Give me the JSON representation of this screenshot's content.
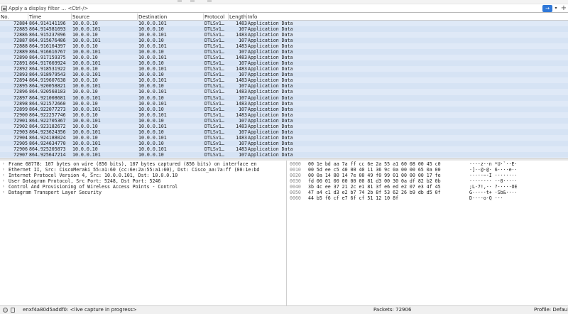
{
  "filter": {
    "placeholder": "Apply a display filter … <Ctrl-/>",
    "apply_glyph": "→",
    "dropdown_glyph": "▾",
    "add_glyph": "+"
  },
  "columns": [
    "No.",
    "Time",
    "Source",
    "Destination",
    "Protocol",
    "Length",
    "Info"
  ],
  "packets": [
    {
      "no": "72884",
      "time": "864.914141196",
      "src": "10.0.0.10",
      "dst": "10.0.0.101",
      "proto": "DTLSv1…",
      "len": "1483",
      "info": "Application Data"
    },
    {
      "no": "72885",
      "time": "864.914581693",
      "src": "10.0.0.101",
      "dst": "10.0.0.10",
      "proto": "DTLSv1…",
      "len": "107",
      "info": "Application Data"
    },
    {
      "no": "72886",
      "time": "864.915237096",
      "src": "10.0.0.10",
      "dst": "10.0.0.101",
      "proto": "DTLSv1…",
      "len": "1483",
      "info": "Application Data"
    },
    {
      "no": "72887",
      "time": "864.915676486",
      "src": "10.0.0.101",
      "dst": "10.0.0.10",
      "proto": "DTLSv1…",
      "len": "107",
      "info": "Application Data"
    },
    {
      "no": "72888",
      "time": "864.916164397",
      "src": "10.0.0.10",
      "dst": "10.0.0.101",
      "proto": "DTLSv1…",
      "len": "1483",
      "info": "Application Data"
    },
    {
      "no": "72889",
      "time": "864.916616767",
      "src": "10.0.0.101",
      "dst": "10.0.0.10",
      "proto": "DTLSv1…",
      "len": "107",
      "info": "Application Data"
    },
    {
      "no": "72890",
      "time": "864.917159375",
      "src": "10.0.0.10",
      "dst": "10.0.0.101",
      "proto": "DTLSv1…",
      "len": "1483",
      "info": "Application Data"
    },
    {
      "no": "72891",
      "time": "864.917669924",
      "src": "10.0.0.101",
      "dst": "10.0.0.10",
      "proto": "DTLSv1…",
      "len": "107",
      "info": "Application Data"
    },
    {
      "no": "72892",
      "time": "864.918531922",
      "src": "10.0.0.10",
      "dst": "10.0.0.101",
      "proto": "DTLSv1…",
      "len": "1483",
      "info": "Application Data"
    },
    {
      "no": "72893",
      "time": "864.918979543",
      "src": "10.0.0.101",
      "dst": "10.0.0.10",
      "proto": "DTLSv1…",
      "len": "107",
      "info": "Application Data"
    },
    {
      "no": "72894",
      "time": "864.919607638",
      "src": "10.0.0.10",
      "dst": "10.0.0.101",
      "proto": "DTLSv1…",
      "len": "1483",
      "info": "Application Data"
    },
    {
      "no": "72895",
      "time": "864.920058821",
      "src": "10.0.0.101",
      "dst": "10.0.0.10",
      "proto": "DTLSv1…",
      "len": "107",
      "info": "Application Data"
    },
    {
      "no": "72896",
      "time": "864.920568183",
      "src": "10.0.0.10",
      "dst": "10.0.0.101",
      "proto": "DTLSv1…",
      "len": "1483",
      "info": "Application Data"
    },
    {
      "no": "72897",
      "time": "864.921008681",
      "src": "10.0.0.101",
      "dst": "10.0.0.10",
      "proto": "DTLSv1…",
      "len": "107",
      "info": "Application Data"
    },
    {
      "no": "72898",
      "time": "864.921572660",
      "src": "10.0.0.10",
      "dst": "10.0.0.101",
      "proto": "DTLSv1…",
      "len": "1483",
      "info": "Application Data"
    },
    {
      "no": "72899",
      "time": "864.922077273",
      "src": "10.0.0.101",
      "dst": "10.0.0.10",
      "proto": "DTLSv1…",
      "len": "107",
      "info": "Application Data"
    },
    {
      "no": "72900",
      "time": "864.922257746",
      "src": "10.0.0.10",
      "dst": "10.0.0.101",
      "proto": "DTLSv1…",
      "len": "1483",
      "info": "Application Data"
    },
    {
      "no": "72901",
      "time": "864.922705367",
      "src": "10.0.0.101",
      "dst": "10.0.0.10",
      "proto": "DTLSv1…",
      "len": "107",
      "info": "Application Data"
    },
    {
      "no": "72902",
      "time": "864.923182672",
      "src": "10.0.0.10",
      "dst": "10.0.0.101",
      "proto": "DTLSv1…",
      "len": "1483",
      "info": "Application Data"
    },
    {
      "no": "72903",
      "time": "864.923624356",
      "src": "10.0.0.101",
      "dst": "10.0.0.10",
      "proto": "DTLSv1…",
      "len": "107",
      "info": "Application Data"
    },
    {
      "no": "72904",
      "time": "864.924188024",
      "src": "10.0.0.10",
      "dst": "10.0.0.101",
      "proto": "DTLSv1…",
      "len": "1483",
      "info": "Application Data"
    },
    {
      "no": "72905",
      "time": "864.924634770",
      "src": "10.0.0.101",
      "dst": "10.0.0.10",
      "proto": "DTLSv1…",
      "len": "107",
      "info": "Application Data"
    },
    {
      "no": "72906",
      "time": "864.925205873",
      "src": "10.0.0.10",
      "dst": "10.0.0.101",
      "proto": "DTLSv1…",
      "len": "1483",
      "info": "Application Data"
    },
    {
      "no": "72907",
      "time": "864.925647214",
      "src": "10.0.0.101",
      "dst": "10.0.0.10",
      "proto": "DTLSv1…",
      "len": "107",
      "info": "Application Data"
    }
  ],
  "details": [
    "Frame 68778: 107 bytes on wire (856 bits), 107 bytes captured (856 bits) on interface en",
    "Ethernet II, Src: CiscoMeraki_55:a1:60 (cc:6e:2a:55:a1:60), Dst: Cisco_aa:7a:ff (00:1e:bd",
    "Internet Protocol Version 4, Src: 10.0.0.101, Dst: 10.0.0.10",
    "User Datagram Protocol, Src Port: 5248, Dst Port: 5246",
    "Control And Provisioning of Wireless Access Points - Control",
    "Datagram Transport Layer Security"
  ],
  "expander_glyph": "›",
  "bytes": [
    {
      "offset": "0000",
      "hex": "00 1e bd aa 7a ff cc 6e  2a 55 a1 60 08 00 45 c0",
      "ascii": "····z··n *U·`··E·"
    },
    {
      "offset": "0010",
      "hex": "00 5d ee c5 40 00 40 11  36 9c 0a 00 00 65 0a 00",
      "ascii": "·]··@·@· 6····e··"
    },
    {
      "offset": "0020",
      "hex": "00 0a 14 80 14 7e 00 49  f0 99 01 00 00 00 17 fe",
      "ascii": "·····~·I ········"
    },
    {
      "offset": "0030",
      "hex": "fd 00 01 00 00 00 00 81  d3 00 30 0a df 82 b2 0b",
      "ascii": "········ ··0·····"
    },
    {
      "offset": "0040",
      "hex": "3b 4c ee 37 21 2c e1 81  3f e6 ed e2 07 e3 4f 45",
      "ascii": ";L·7!,·· ?·····OE"
    },
    {
      "offset": "0050",
      "hex": "47 a4 c1 d3 e2 b7 74 2b  8f 53 62 26 b9 db d5 0f",
      "ascii": "G·····t+ ·Sb&····"
    },
    {
      "offset": "0060",
      "hex": "44 b5 f6 cf e7 6f cf 51  12 10 8f",
      "ascii": "D····o·Q ···"
    }
  ],
  "status": {
    "capture": "enxf4a80d5addf0: <live capture in progress>",
    "packets": "Packets: 72906",
    "profile": "Profile: Default"
  }
}
